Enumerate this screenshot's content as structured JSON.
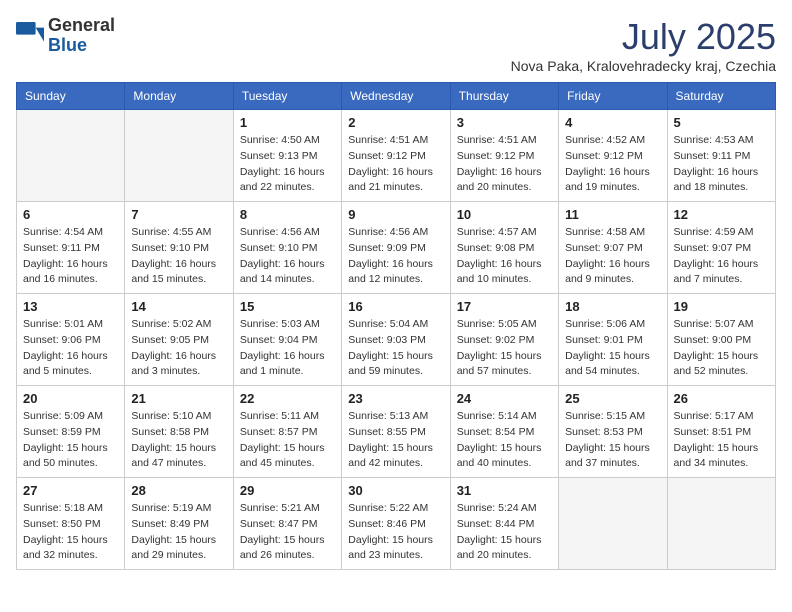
{
  "header": {
    "logo_general": "General",
    "logo_blue": "Blue",
    "month_title": "July 2025",
    "subtitle": "Nova Paka, Kralovehradecky kraj, Czechia"
  },
  "days_of_week": [
    "Sunday",
    "Monday",
    "Tuesday",
    "Wednesday",
    "Thursday",
    "Friday",
    "Saturday"
  ],
  "weeks": [
    [
      {
        "day": "",
        "detail": ""
      },
      {
        "day": "",
        "detail": ""
      },
      {
        "day": "1",
        "detail": "Sunrise: 4:50 AM\nSunset: 9:13 PM\nDaylight: 16 hours\nand 22 minutes."
      },
      {
        "day": "2",
        "detail": "Sunrise: 4:51 AM\nSunset: 9:12 PM\nDaylight: 16 hours\nand 21 minutes."
      },
      {
        "day": "3",
        "detail": "Sunrise: 4:51 AM\nSunset: 9:12 PM\nDaylight: 16 hours\nand 20 minutes."
      },
      {
        "day": "4",
        "detail": "Sunrise: 4:52 AM\nSunset: 9:12 PM\nDaylight: 16 hours\nand 19 minutes."
      },
      {
        "day": "5",
        "detail": "Sunrise: 4:53 AM\nSunset: 9:11 PM\nDaylight: 16 hours\nand 18 minutes."
      }
    ],
    [
      {
        "day": "6",
        "detail": "Sunrise: 4:54 AM\nSunset: 9:11 PM\nDaylight: 16 hours\nand 16 minutes."
      },
      {
        "day": "7",
        "detail": "Sunrise: 4:55 AM\nSunset: 9:10 PM\nDaylight: 16 hours\nand 15 minutes."
      },
      {
        "day": "8",
        "detail": "Sunrise: 4:56 AM\nSunset: 9:10 PM\nDaylight: 16 hours\nand 14 minutes."
      },
      {
        "day": "9",
        "detail": "Sunrise: 4:56 AM\nSunset: 9:09 PM\nDaylight: 16 hours\nand 12 minutes."
      },
      {
        "day": "10",
        "detail": "Sunrise: 4:57 AM\nSunset: 9:08 PM\nDaylight: 16 hours\nand 10 minutes."
      },
      {
        "day": "11",
        "detail": "Sunrise: 4:58 AM\nSunset: 9:07 PM\nDaylight: 16 hours\nand 9 minutes."
      },
      {
        "day": "12",
        "detail": "Sunrise: 4:59 AM\nSunset: 9:07 PM\nDaylight: 16 hours\nand 7 minutes."
      }
    ],
    [
      {
        "day": "13",
        "detail": "Sunrise: 5:01 AM\nSunset: 9:06 PM\nDaylight: 16 hours\nand 5 minutes."
      },
      {
        "day": "14",
        "detail": "Sunrise: 5:02 AM\nSunset: 9:05 PM\nDaylight: 16 hours\nand 3 minutes."
      },
      {
        "day": "15",
        "detail": "Sunrise: 5:03 AM\nSunset: 9:04 PM\nDaylight: 16 hours\nand 1 minute."
      },
      {
        "day": "16",
        "detail": "Sunrise: 5:04 AM\nSunset: 9:03 PM\nDaylight: 15 hours\nand 59 minutes."
      },
      {
        "day": "17",
        "detail": "Sunrise: 5:05 AM\nSunset: 9:02 PM\nDaylight: 15 hours\nand 57 minutes."
      },
      {
        "day": "18",
        "detail": "Sunrise: 5:06 AM\nSunset: 9:01 PM\nDaylight: 15 hours\nand 54 minutes."
      },
      {
        "day": "19",
        "detail": "Sunrise: 5:07 AM\nSunset: 9:00 PM\nDaylight: 15 hours\nand 52 minutes."
      }
    ],
    [
      {
        "day": "20",
        "detail": "Sunrise: 5:09 AM\nSunset: 8:59 PM\nDaylight: 15 hours\nand 50 minutes."
      },
      {
        "day": "21",
        "detail": "Sunrise: 5:10 AM\nSunset: 8:58 PM\nDaylight: 15 hours\nand 47 minutes."
      },
      {
        "day": "22",
        "detail": "Sunrise: 5:11 AM\nSunset: 8:57 PM\nDaylight: 15 hours\nand 45 minutes."
      },
      {
        "day": "23",
        "detail": "Sunrise: 5:13 AM\nSunset: 8:55 PM\nDaylight: 15 hours\nand 42 minutes."
      },
      {
        "day": "24",
        "detail": "Sunrise: 5:14 AM\nSunset: 8:54 PM\nDaylight: 15 hours\nand 40 minutes."
      },
      {
        "day": "25",
        "detail": "Sunrise: 5:15 AM\nSunset: 8:53 PM\nDaylight: 15 hours\nand 37 minutes."
      },
      {
        "day": "26",
        "detail": "Sunrise: 5:17 AM\nSunset: 8:51 PM\nDaylight: 15 hours\nand 34 minutes."
      }
    ],
    [
      {
        "day": "27",
        "detail": "Sunrise: 5:18 AM\nSunset: 8:50 PM\nDaylight: 15 hours\nand 32 minutes."
      },
      {
        "day": "28",
        "detail": "Sunrise: 5:19 AM\nSunset: 8:49 PM\nDaylight: 15 hours\nand 29 minutes."
      },
      {
        "day": "29",
        "detail": "Sunrise: 5:21 AM\nSunset: 8:47 PM\nDaylight: 15 hours\nand 26 minutes."
      },
      {
        "day": "30",
        "detail": "Sunrise: 5:22 AM\nSunset: 8:46 PM\nDaylight: 15 hours\nand 23 minutes."
      },
      {
        "day": "31",
        "detail": "Sunrise: 5:24 AM\nSunset: 8:44 PM\nDaylight: 15 hours\nand 20 minutes."
      },
      {
        "day": "",
        "detail": ""
      },
      {
        "day": "",
        "detail": ""
      }
    ]
  ]
}
